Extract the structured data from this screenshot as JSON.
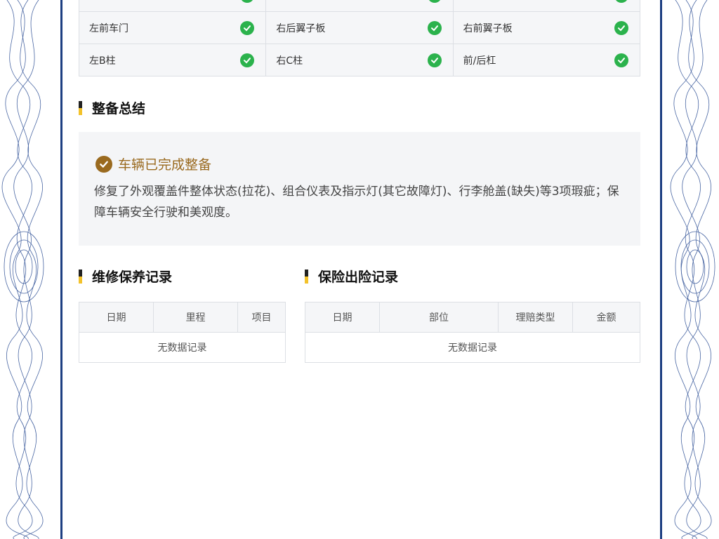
{
  "inspection_rows": [
    [
      {
        "label": "",
        "status": "ok"
      },
      {
        "label": "",
        "status": "ok"
      },
      {
        "label": "",
        "status": "ok"
      }
    ],
    [
      {
        "label": "左前车门",
        "status": "ok"
      },
      {
        "label": "右后翼子板",
        "status": "ok"
      },
      {
        "label": "右前翼子板",
        "status": "ok"
      }
    ],
    [
      {
        "label": "左B柱",
        "status": "ok"
      },
      {
        "label": "右C柱",
        "status": "ok"
      },
      {
        "label": "前/后杠",
        "status": "ok"
      }
    ]
  ],
  "summary": {
    "section_title": "整备总结",
    "status_title": "车辆已完成整备",
    "text": "修复了外观覆盖件整体状态(拉花)、组合仪表及指示灯(其它故障灯)、行李舱盖(缺失)等3项瑕疵；保障车辆安全行驶和美观度。"
  },
  "maintenance": {
    "section_title": "维修保养记录",
    "columns": [
      "日期",
      "里程",
      "项目"
    ],
    "empty_text": "无数据记录"
  },
  "insurance": {
    "section_title": "保险出险记录",
    "columns": [
      "日期",
      "部位",
      "理赔类型",
      "金额"
    ],
    "empty_text": "无数据记录"
  },
  "colors": {
    "frame": "#1d3f82",
    "ok": "#2bb24c",
    "accent_gold": "#9a6a1f",
    "bar_yellow": "#f3c22b"
  },
  "icons": {
    "ok": "check-circle-icon",
    "summary": "check-circle-icon"
  }
}
